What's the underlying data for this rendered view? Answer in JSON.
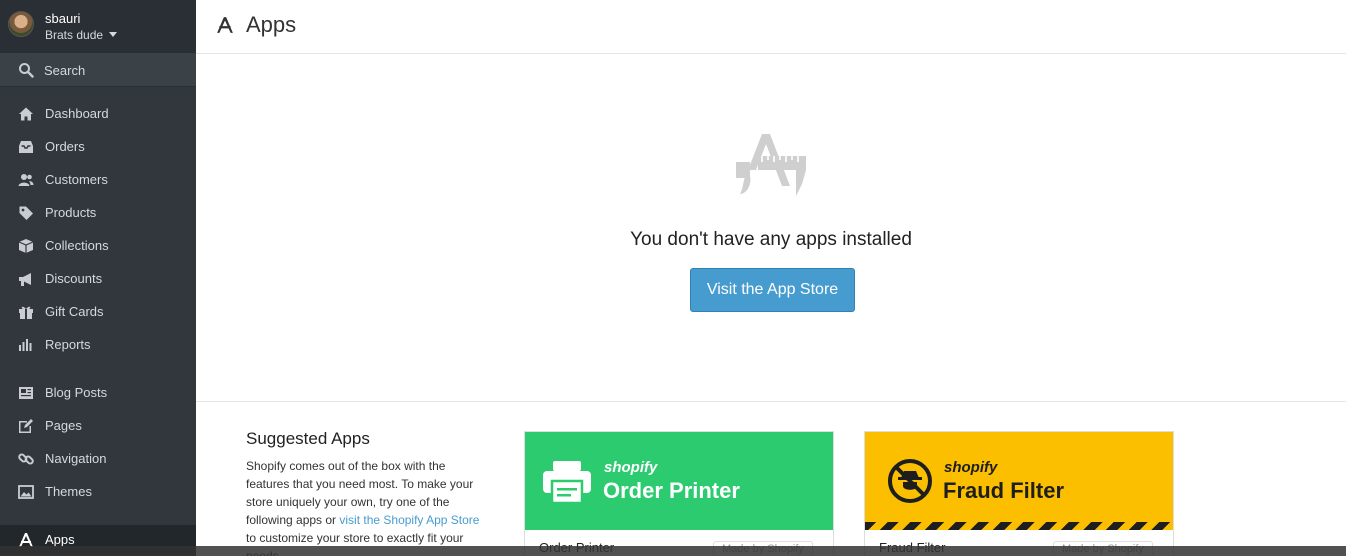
{
  "user": {
    "name": "sbauri",
    "store": "Brats dude"
  },
  "search": {
    "label": "Search"
  },
  "nav": [
    {
      "label": "Dashboard",
      "icon": "home-icon"
    },
    {
      "label": "Orders",
      "icon": "inbox-icon"
    },
    {
      "label": "Customers",
      "icon": "users-icon"
    },
    {
      "label": "Products",
      "icon": "tag-icon"
    },
    {
      "label": "Collections",
      "icon": "box-icon"
    },
    {
      "label": "Discounts",
      "icon": "megaphone-icon"
    },
    {
      "label": "Gift Cards",
      "icon": "gift-icon"
    },
    {
      "label": "Reports",
      "icon": "bar-chart-icon"
    },
    {
      "label": "Blog Posts",
      "icon": "newspaper-icon"
    },
    {
      "label": "Pages",
      "icon": "edit-icon"
    },
    {
      "label": "Navigation",
      "icon": "link-icon"
    },
    {
      "label": "Themes",
      "icon": "image-icon"
    },
    {
      "label": "Apps",
      "icon": "apps-icon",
      "active": true
    }
  ],
  "header": {
    "title": "Apps"
  },
  "empty_state": {
    "message": "You don't have any apps installed",
    "button": "Visit the App Store"
  },
  "suggested": {
    "title": "Suggested Apps",
    "text_before": "Shopify comes out of the box with the features that you need most. To make your store uniquely your own, try one of the following apps or ",
    "link": "visit the Shopify App Store",
    "text_after": " to customize your store to exactly fit your needs.",
    "cards": [
      {
        "brand": "shopify",
        "product": "Order Printer",
        "name": "Order Printer",
        "madeby": "Made by Shopify",
        "color": "#2dcb6f"
      },
      {
        "brand": "shopify",
        "product": "Fraud Filter",
        "name": "Fraud Filter",
        "madeby": "Made by Shopify",
        "color": "#fcbf00"
      }
    ]
  },
  "colors": {
    "sidebar": "#31373d",
    "accent": "#479ccf"
  }
}
